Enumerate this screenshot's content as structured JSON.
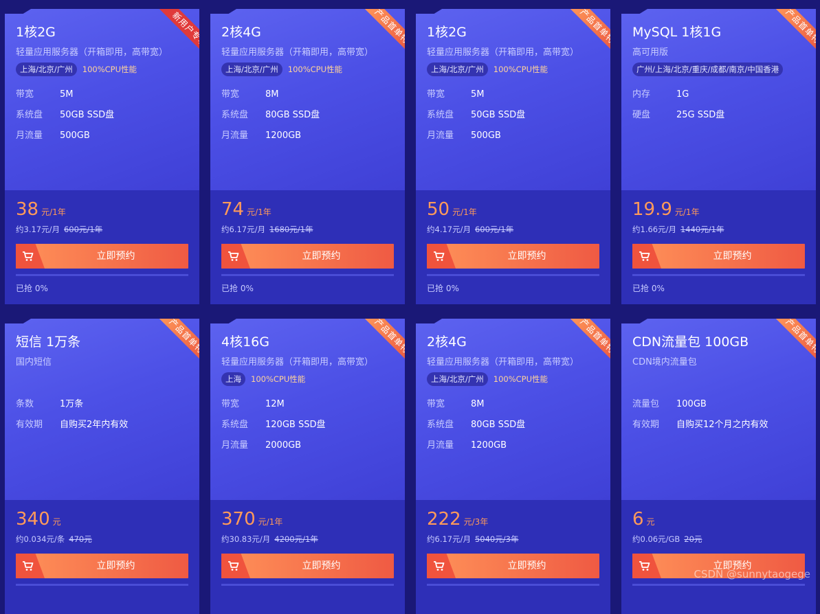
{
  "colors": {
    "background": "#1a1877",
    "accent": "#ff9a5a",
    "button": "#f0533d"
  },
  "buy_label": "立即预约",
  "watermark": "CSDN @sunnytaogege",
  "cards": [
    {
      "ribbon": "新用户专享",
      "ribbon_style": "red",
      "title": "1核2G",
      "subtitle": "轻量应用服务器（开箱即用，高带宽）",
      "region": "上海/北京/广州",
      "cpu": "100%CPU性能",
      "specs": [
        [
          "带宽",
          "5M"
        ],
        [
          "系统盘",
          "50GB SSD盘"
        ],
        [
          "月流量",
          "500GB"
        ]
      ],
      "price": "38",
      "unit": "元/1年",
      "per": "约3.17元/月",
      "orig": "600元/1年",
      "sold": "已抢 0%",
      "sold_fraction": 0
    },
    {
      "ribbon": "产品首单特惠",
      "ribbon_style": "orange",
      "title": "2核4G",
      "subtitle": "轻量应用服务器（开箱即用，高带宽）",
      "region": "上海/北京/广州",
      "cpu": "100%CPU性能",
      "specs": [
        [
          "带宽",
          "8M"
        ],
        [
          "系统盘",
          "80GB SSD盘"
        ],
        [
          "月流量",
          "1200GB"
        ]
      ],
      "price": "74",
      "unit": "元/1年",
      "per": "约6.17元/月",
      "orig": "1680元/1年",
      "sold": "已抢 0%",
      "sold_fraction": 0
    },
    {
      "ribbon": "产品首单特惠",
      "ribbon_style": "orange",
      "title": "1核2G",
      "subtitle": "轻量应用服务器（开箱即用，高带宽）",
      "region": "上海/北京/广州",
      "cpu": "100%CPU性能",
      "specs": [
        [
          "带宽",
          "5M"
        ],
        [
          "系统盘",
          "50GB SSD盘"
        ],
        [
          "月流量",
          "500GB"
        ]
      ],
      "price": "50",
      "unit": "元/1年",
      "per": "约4.17元/月",
      "orig": "600元/1年",
      "sold": "已抢 0%",
      "sold_fraction": 0
    },
    {
      "ribbon": "产品首单特惠",
      "ribbon_style": "orange",
      "title": "MySQL 1核1G",
      "subtitle": "高可用版",
      "region": "广州/上海/北京/重庆/成都/南京/中国香港",
      "cpu": "",
      "specs": [
        [
          "内存",
          "1G"
        ],
        [
          "硬盘",
          "25G SSD盘"
        ]
      ],
      "price": "19.9",
      "unit": "元/1年",
      "per": "约1.66元/月",
      "orig": "1440元/1年",
      "sold": "已抢 0%",
      "sold_fraction": 0
    },
    {
      "ribbon": "产品首单特惠",
      "ribbon_style": "orange",
      "title": "短信 1万条",
      "subtitle": "国内短信",
      "region": "",
      "cpu": "",
      "specs": [
        [
          "条数",
          "1万条"
        ],
        [
          "有效期",
          "自购买2年内有效"
        ]
      ],
      "price": "340",
      "unit": "元",
      "per": "约0.034元/条",
      "orig": "470元",
      "sold": "",
      "sold_fraction": 0
    },
    {
      "ribbon": "产品首单特惠",
      "ribbon_style": "orange",
      "title": "4核16G",
      "subtitle": "轻量应用服务器（开箱即用，高带宽）",
      "region": "上海",
      "cpu": "100%CPU性能",
      "specs": [
        [
          "带宽",
          "12M"
        ],
        [
          "系统盘",
          "120GB SSD盘"
        ],
        [
          "月流量",
          "2000GB"
        ]
      ],
      "price": "370",
      "unit": "元/1年",
      "per": "约30.83元/月",
      "orig": "4200元/1年",
      "sold": "",
      "sold_fraction": 0
    },
    {
      "ribbon": "产品首单特惠",
      "ribbon_style": "orange",
      "title": "2核4G",
      "subtitle": "轻量应用服务器（开箱即用，高带宽）",
      "region": "上海/北京/广州",
      "cpu": "100%CPU性能",
      "specs": [
        [
          "带宽",
          "8M"
        ],
        [
          "系统盘",
          "80GB SSD盘"
        ],
        [
          "月流量",
          "1200GB"
        ]
      ],
      "price": "222",
      "unit": "元/3年",
      "per": "约6.17元/月",
      "orig": "5040元/3年",
      "sold": "",
      "sold_fraction": 0
    },
    {
      "ribbon": "产品首单特惠",
      "ribbon_style": "orange",
      "title": "CDN流量包 100GB",
      "subtitle": "CDN境内流量包",
      "region": "",
      "cpu": "",
      "specs": [
        [
          "流量包",
          "100GB"
        ],
        [
          "有效期",
          "自购买12个月之内有效"
        ]
      ],
      "price": "6",
      "unit": "元",
      "per": "约0.06元/GB",
      "orig": "20元",
      "sold": "",
      "sold_fraction": 0
    }
  ]
}
